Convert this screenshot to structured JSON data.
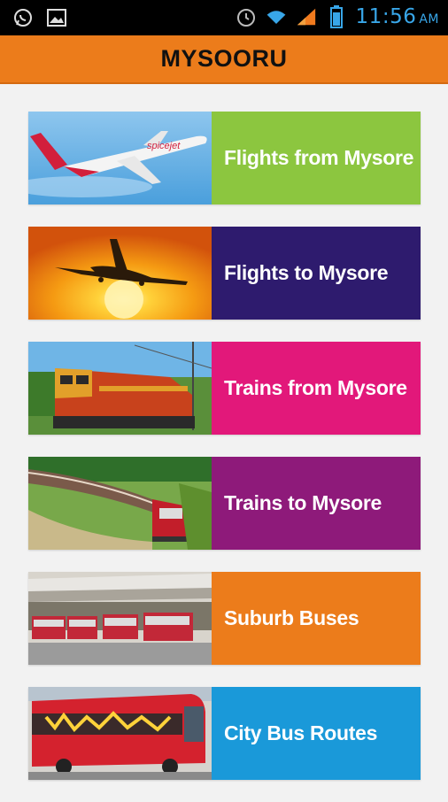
{
  "status_bar": {
    "time": "11:56",
    "ampm": "AM",
    "icons": [
      "whatsapp-icon",
      "gallery-icon",
      "alarm-icon",
      "wifi-icon",
      "signal-icon",
      "battery-icon"
    ]
  },
  "app_bar": {
    "title": "MYSOORU"
  },
  "menu": {
    "items": [
      {
        "label": "Flights from Mysore",
        "color": "#8cc63f",
        "image": "airplane-takeoff-photo"
      },
      {
        "label": "Flights to Mysore",
        "color": "#2e1b6e",
        "image": "airplane-sunset-photo"
      },
      {
        "label": "Trains from Mysore",
        "color": "#e2187a",
        "image": "locomotive-photo"
      },
      {
        "label": "Trains to Mysore",
        "color": "#8e1a7a",
        "image": "train-curve-photo"
      },
      {
        "label": "Suburb Buses",
        "color": "#ec7c1b",
        "image": "bus-station-photo"
      },
      {
        "label": "City Bus Routes",
        "color": "#1a99d9",
        "image": "city-bus-photo"
      }
    ]
  }
}
